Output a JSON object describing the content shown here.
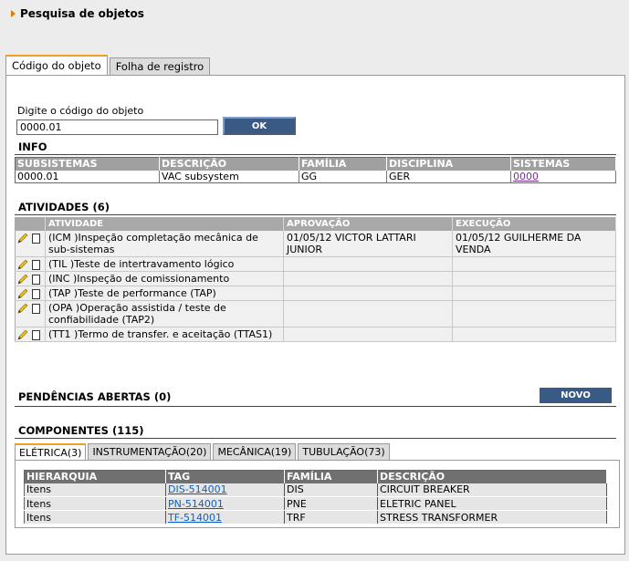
{
  "page": {
    "title": "Pesquisa de objetos"
  },
  "tabs": [
    "Código do objeto",
    "Folha de registro"
  ],
  "search": {
    "label": "Digite o código do objeto",
    "value": "0000.01",
    "ok_label": "OK"
  },
  "info": {
    "title": "INFO",
    "headers": [
      "SUBSISTEMAS",
      "DESCRIÇÃO",
      "FAMÍLIA",
      "DISCIPLINA",
      "SISTEMAS"
    ],
    "row": [
      "0000.01",
      "VAC subsystem",
      "GG",
      "GER",
      "0000"
    ]
  },
  "activities": {
    "title": "ATIVIDADES (6)",
    "headers": [
      "ATIVIDADE",
      "APROVAÇÃO",
      "EXECUÇÃO"
    ],
    "rows": [
      [
        "(ICM )Inspeção completação mecânica de sub-sistemas",
        "01/05/12 VICTOR LATTARI JUNIOR",
        "01/05/12 GUILHERME DA VENDA"
      ],
      [
        "(TIL )Teste de intertravamento lógico",
        "",
        ""
      ],
      [
        "(INC )Inspeção de comissionamento",
        "",
        ""
      ],
      [
        "(TAP )Teste de performance (TAP)",
        "",
        ""
      ],
      [
        "(OPA )Operação assistida / teste de confiabilidade (TAP2)",
        "",
        ""
      ],
      [
        "(TT1 )Termo de transfer. e aceitação (TTAS1)",
        "",
        ""
      ]
    ]
  },
  "pendencias": {
    "title": "PENDÊNCIAS ABERTAS (0)",
    "novo_label": "NOVO"
  },
  "components": {
    "title": "COMPONENTES (115)",
    "tabs": [
      "ELÉTRICA(3)",
      "INSTRUMENTAÇÃO(20)",
      "MECÂNICA(19)",
      "TUBULAÇÃO(73)"
    ],
    "headers": [
      "HIERARQUIA",
      "TAG",
      "FAMÍLIA",
      "DESCRIÇÃO"
    ],
    "rows": [
      [
        "Itens",
        "DIS-514001",
        "DIS",
        "CIRCUIT BREAKER"
      ],
      [
        "Itens",
        "PN-514001",
        "PNE",
        "ELETRIC PANEL"
      ],
      [
        "Itens",
        "TF-514001",
        "TRF",
        "STRESS TRANSFORMER"
      ]
    ]
  },
  "colors": {
    "button": "#3a5a86",
    "tab_accent": "#f0a020",
    "header_arrow": "#e07b00"
  },
  "icons": {
    "edit": "pencil-icon",
    "document": "document-icon",
    "header": "arrow-right-icon"
  }
}
